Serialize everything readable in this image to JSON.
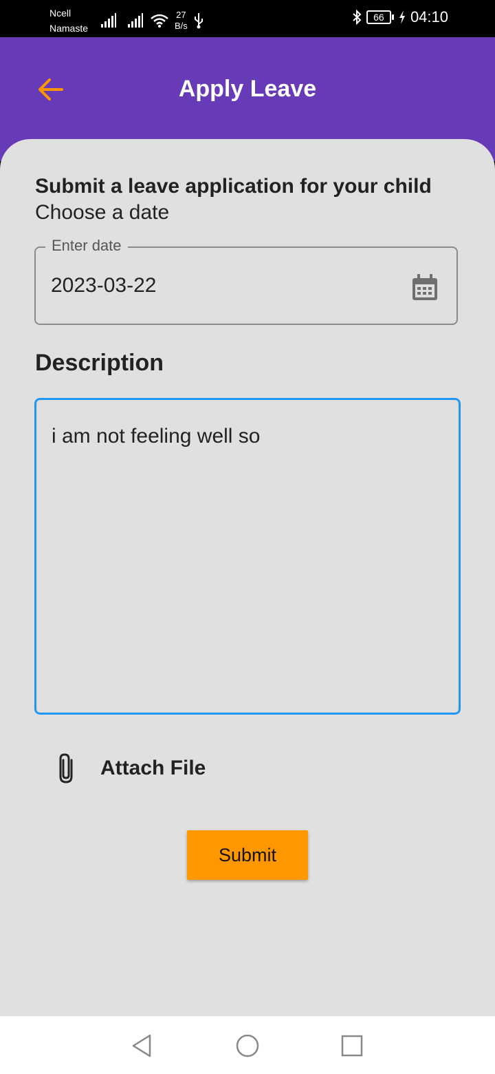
{
  "status_bar": {
    "carrier_line1": "Ncell",
    "carrier_line2": "Namaste",
    "net_speed_value": "27",
    "net_speed_unit": "B/s",
    "battery_level": "66",
    "time": "04:10"
  },
  "app_bar": {
    "title": "Apply Leave",
    "back_icon": "arrow-left-icon",
    "accent_color": "#ff9800",
    "background_color": "#673ab7"
  },
  "form": {
    "heading": "Submit a leave application for your child",
    "subheading": "Choose a date",
    "date_field": {
      "label": "Enter date",
      "value": "2023-03-22",
      "icon": "calendar-icon"
    },
    "description_label": "Description",
    "description_value": "i am not feeling well so",
    "attach_label": "Attach File",
    "attach_icon": "paperclip-icon",
    "submit_label": "Submit"
  },
  "nav_bar": {
    "back": "triangle-back-icon",
    "home": "circle-home-icon",
    "recents": "square-recents-icon"
  }
}
